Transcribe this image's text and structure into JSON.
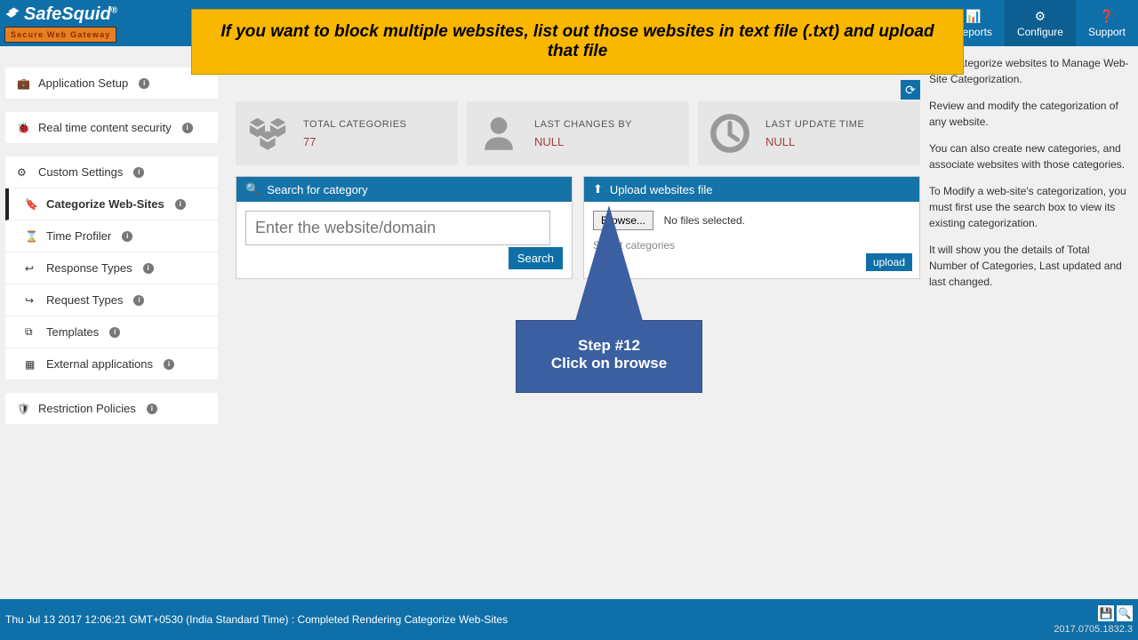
{
  "logo": {
    "name": "SafeSquid",
    "tagline": "Secure Web Gateway"
  },
  "header_nav": {
    "reports": "Reports",
    "configure": "Configure",
    "support": "Support"
  },
  "banner": "If you want to block multiple websites, list out those websites in text file (.txt) and upload that file",
  "sidebar": {
    "app_setup": "Application Setup",
    "realtime": "Real time content security",
    "custom": "Custom Settings",
    "categorize": "Categorize Web-Sites",
    "time_profiler": "Time Profiler",
    "response_types": "Response Types",
    "request_types": "Request Types",
    "templates": "Templates",
    "external_apps": "External applications",
    "restriction": "Restriction Policies"
  },
  "stats": {
    "total_categories": {
      "label": "TOTAL CATEGORIES",
      "value": "77"
    },
    "last_changes_by": {
      "label": "LAST CHANGES BY",
      "value": "NULL"
    },
    "last_update_time": {
      "label": "LAST UPDATE TIME",
      "value": "NULL"
    }
  },
  "search_panel": {
    "title": "Search for category",
    "placeholder": "Enter the website/domain",
    "search_button": "Search"
  },
  "upload_panel": {
    "title": "Upload websites file",
    "browse_button": "Browse...",
    "no_file_text": "No files selected.",
    "select_categories_text": "Select categories",
    "upload_button": "upload"
  },
  "help_text": {
    "p1": "Use Categorize websites to Manage Web-Site Categorization.",
    "p2": "Review and modify the categorization of any website.",
    "p3": "You can also create new categories, and associate websites with those categories.",
    "p4": "To Modify a web-site's categorization, you must first use the search box to view its existing categorization.",
    "p5": "It will show you the details of Total Number of Categories, Last updated and last changed."
  },
  "callout": {
    "step": "Step #12",
    "instruction": "Click on browse"
  },
  "footer": {
    "status": "Thu Jul 13 2017 12:06:21 GMT+0530 (India Standard Time) : Completed Rendering Categorize Web-Sites",
    "version": "2017.0705.1832.3"
  }
}
